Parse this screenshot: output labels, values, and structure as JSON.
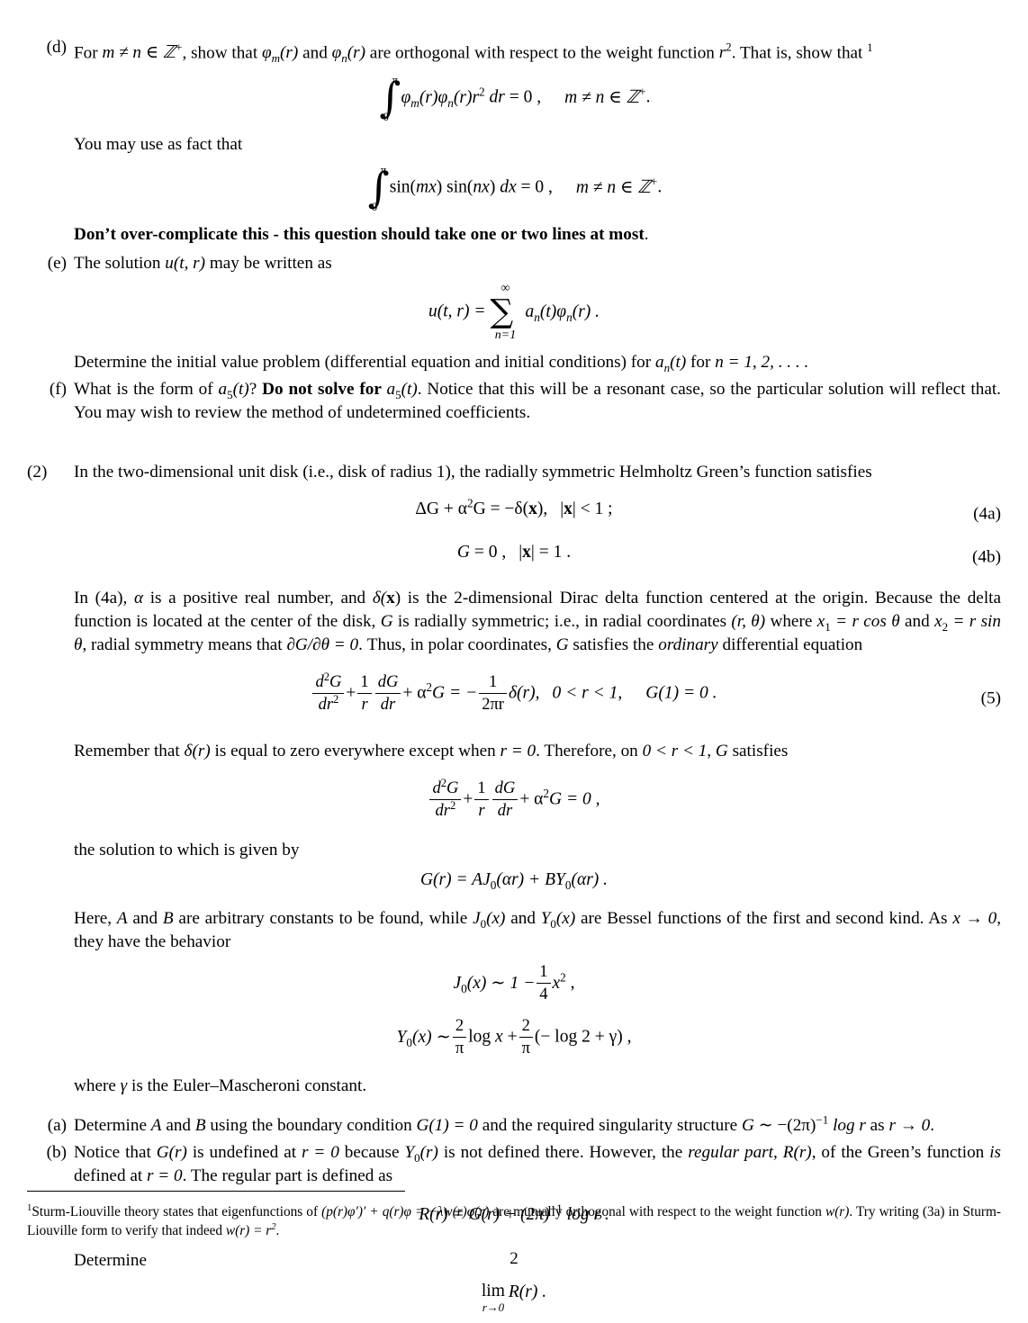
{
  "document": {
    "page_number": "2"
  },
  "part_d": {
    "label": "(d)",
    "line1_pre": "For ",
    "line1_math1": "m ≠ n ∈ ℤ",
    "line1_math1_sup": "+",
    "line1_mid": ", show that ",
    "phi_m": "φ",
    "sub_m": "m",
    "of_r": "(r)",
    "and": " and ",
    "phi_n": "φ",
    "sub_n": "n",
    "line1_post": " are orthogonal with respect to the weight function ",
    "r_weight": "r",
    "r_weight_sup": "2",
    "that_is": ". That is,",
    "show_that": "show that",
    "footnote_marker": "1",
    "eq_integral_upper": "π",
    "eq_integral_lower": "0",
    "eq_integrand": "φ",
    "eq_body": "(r)φ",
    "eq_tail": "(r)r",
    "eq_tail_sup": "2",
    "eq_dr": "dr",
    "eq_equals": "= 0 ,",
    "eq_cond": "m ≠ n ∈ ℤ",
    "eq_cond_sup": "+",
    "eq_period": ".",
    "fact_intro": "You may use as fact that",
    "eq2_upper": "π",
    "eq2_lower": "0",
    "eq2_body": "sin(mx) sin(nx) dx",
    "eq2_equals": "= 0 ,",
    "eq2_cond": "m ≠ n ∈ ℤ",
    "eq2_cond_sup": "+",
    "eq2_period": ".",
    "warning_bold": "Don’t over-complicate this - this question should take one or two lines at most",
    "warning_period": "."
  },
  "part_e": {
    "label": "(e)",
    "line1_pre": "The solution ",
    "u_tr": "u(t, r)",
    "line1_post": " may be written as",
    "eq_lhs": "u(t, r) =",
    "sum_upper": "∞",
    "sum_lower": "n=1",
    "sum_body": "a",
    "sum_sub1": "n",
    "sum_mid": "(t)φ",
    "sum_sub2": "n",
    "sum_tail": "(r) .",
    "determine_pre": "Determine the initial value problem (differential equation and initial conditions) for ",
    "a_n": "a",
    "a_n_sub": "n",
    "a_n_t": "(t)",
    "determine_mid": " for ",
    "n_eq": "n = 1, 2, . . . ."
  },
  "part_f": {
    "label": "(f)",
    "pre": "What is the form of ",
    "a5_1": "a",
    "a5_1_sub": "5",
    "a5_1_t": "(t)",
    "q_mark": "? ",
    "bold": "Do not solve for ",
    "a5_2": "a",
    "a5_2_sub": "5",
    "a5_2_t": "(t)",
    "post": ". Notice that this will be a resonant case, so the particular solution will reflect that. You may wish to review the method of undetermined coefficients."
  },
  "problem_2": {
    "label": "(2)",
    "intro": "In the two-dimensional unit disk (i.e., disk of radius 1), the radially symmetric Helmholtz Green’s function satisfies",
    "eq_4a": {
      "body": "ΔG + α",
      "sup": "2",
      "body2": "G = −δ(",
      "vec": "x",
      "body3": "),",
      "cond_abs1": "|",
      "cond_vec": "x",
      "cond_abs2": "| < 1 ;",
      "number": "(4a)"
    },
    "eq_4b": {
      "body": "G = 0 ,",
      "cond_abs1": "|",
      "cond_vec": "x",
      "cond_abs2": "| = 1 .",
      "number": "(4b)"
    },
    "para1_a": "In (4a), ",
    "para1_alpha": "α",
    "para1_b": " is a positive real number, and ",
    "para1_delta": "δ(",
    "para1_vec": "x",
    "para1_c": ") is the 2-dimensional Dirac delta function centered at the origin. Because the delta function is located at the center of the disk, ",
    "para1_G": "G",
    "para1_d": " is radially symmetric; i.e., in radial coordinates ",
    "para1_coords": "(r, θ)",
    "para1_e": " where ",
    "para1_x1": "x",
    "para1_x1sub": "1",
    "para1_f": " = r cos θ",
    "para1_g": " and ",
    "para1_x2": "x",
    "para1_x2sub": "2",
    "para1_h": " = r sin θ",
    "para1_i": ", radial symmetry means that ",
    "para1_partial": "∂G/∂θ = 0",
    "para1_j": ". Thus, in polar coordinates, ",
    "para1_G2": "G",
    "para1_k": " satisfies the ",
    "para1_ordinary": "ordinary",
    "para1_l": " differential equation",
    "eq_5": {
      "f1_num": "d",
      "f1_num_sup": "2",
      "f1_num_g": "G",
      "f1_den": "dr",
      "f1_den_sup": "2",
      "plus1": "+",
      "f2_num": "1",
      "f2_den": "r",
      "f3_num": "dG",
      "f3_den": "dr",
      "plus2": "+ α",
      "alpha_sup": "2",
      "g_eq": "G = −",
      "f4_num": "1",
      "f4_den": "2πr",
      "delta_r": "δ(r),",
      "range": "0 < r < 1,",
      "bc": "G(1) = 0 .",
      "number": "(5)"
    },
    "para2_a": "Remember that ",
    "para2_delta": "δ(r)",
    "para2_b": " is equal to zero everywhere except when ",
    "para2_r0": "r = 0",
    "para2_c": ". Therefore, on ",
    "para2_range": "0 < r < 1",
    "para2_d": ", ",
    "para2_G": "G",
    "para2_e": " satisfies",
    "eq_6": {
      "f1_num": "d",
      "f1_num_sup": "2",
      "f1_num_g": "G",
      "f1_den": "dr",
      "f1_den_sup": "2",
      "plus1": "+",
      "f2_num": "1",
      "f2_den": "r",
      "f3_num": "dG",
      "f3_den": "dr",
      "plus2": "+ α",
      "alpha_sup": "2",
      "tail": "G = 0 ,"
    },
    "para3": "the solution to which is given by",
    "eq_7": {
      "body": "G(r) = AJ",
      "sub1": "0",
      "mid": "(αr) + BY",
      "sub2": "0",
      "tail": "(αr) ."
    },
    "para4_a": "Here, ",
    "para4_A": "A",
    "para4_b": " and ",
    "para4_B": "B",
    "para4_c": " are arbitrary constants to be found, while ",
    "para4_J0": "J",
    "para4_J0sub": "0",
    "para4_J0x": "(x)",
    "para4_d": " and ",
    "para4_Y0": "Y",
    "para4_Y0sub": "0",
    "para4_Y0x": "(x)",
    "para4_e": " are Bessel functions of the first and second kind. As ",
    "para4_limit": "x → 0",
    "para4_f": ", they have the behavior",
    "eq_J0": {
      "lhs": "J",
      "lhs_sub": "0",
      "lhs_x": "(x) ∼ 1 −",
      "frac_n": "1",
      "frac_d": "4",
      "tail": "x",
      "tail_sup": "2",
      "comma": ","
    },
    "eq_Y0": {
      "lhs": "Y",
      "lhs_sub": "0",
      "lhs_x": "(x) ∼",
      "f1_n": "2",
      "f1_d": "π",
      "mid": "log x +",
      "f2_n": "2",
      "f2_d": "π",
      "tail": "(− log 2 + γ) ,"
    },
    "para5_a": "where ",
    "para5_gamma": "γ",
    "para5_b": " is the Euler–Mascheroni constant."
  },
  "problem_2_part_a": {
    "label": "(a)",
    "pre": "Determine ",
    "A": "A",
    "and": " and ",
    "B": "B",
    "mid": " using the boundary condition ",
    "bc": "G(1) = 0",
    "post": " and the required singularity structure ",
    "G_sim": "G ∼",
    "line2_a": "−(2π)",
    "line2_sup": "−1",
    "line2_b": " log r",
    "line2_c": " as ",
    "line2_d": "r → 0",
    "line2_e": "."
  },
  "problem_2_part_b": {
    "label": "(b)",
    "pre": "Notice that ",
    "Gr": "G(r)",
    "mid1": " is undefined at ",
    "r0": "r = 0",
    "mid2": " because ",
    "Y0": "Y",
    "Y0sub": "0",
    "Y0r": "(r)",
    "mid3": " is not defined there. However, the ",
    "regular_part": "regular part",
    "comma": ", ",
    "Rr": "R(r)",
    "mid4": ", of the Green’s function ",
    "is": "is",
    "mid5": " defined at ",
    "r0b": "r = 0",
    "post": ". The regular part is defined as",
    "eq_R": {
      "body": "R(r) = G(r) + (2π)",
      "sup": "−1",
      "tail": "log r ."
    },
    "determine": "Determine",
    "eq_lim": {
      "lim": "lim",
      "sub": "r→0",
      "body": "R(r) ."
    }
  },
  "footnote": {
    "marker": "1",
    "text_a": "Sturm-Liouville theory states that eigenfunctions of ",
    "math1": "(p(r)φ′)′ + q(r)φ = −λw(r)φ(r)",
    "text_b": " are mutually orthogonal with respect to the weight function ",
    "math2": "w(r)",
    "text_c": ". Try writing (3a) in Sturm-Liouville form to verify that indeed ",
    "math3": "w(r) = r",
    "math3_sup": "2",
    "text_d": "."
  }
}
